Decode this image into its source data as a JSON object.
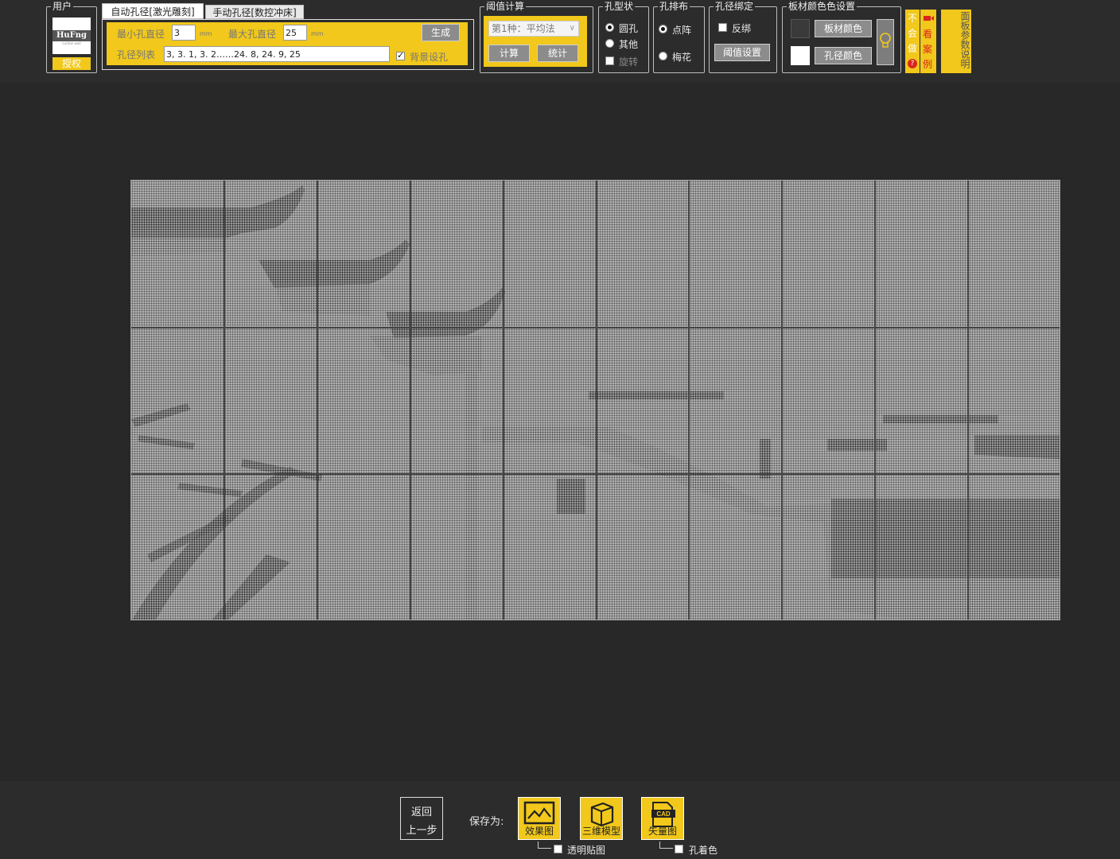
{
  "user_group": {
    "legend": "用户",
    "logo_text": "HuFng",
    "logo_sub": "curtain wall",
    "auth_button": "授权"
  },
  "tabs": [
    {
      "label": "自动孔径[激光雕刻]",
      "active": true
    },
    {
      "label": "手动孔径[数控冲床]",
      "active": false
    }
  ],
  "auto_panel": {
    "min_label": "最小孔直径",
    "min_value": "3",
    "min_unit": "mm",
    "max_label": "最大孔直径",
    "max_value": "25",
    "max_unit": "mm",
    "generate_button": "生成",
    "list_label": "孔径列表",
    "list_value": "3, 3. 1, 3. 2……24. 8, 24. 9, 25",
    "bg_hole_label": "背景设孔",
    "bg_hole_checked": true
  },
  "threshold": {
    "legend": "阈值计算",
    "method_select": "第1种：平均法",
    "calc_button": "计算",
    "stats_button": "统计"
  },
  "hole_shape": {
    "legend": "孔型状",
    "options": [
      "圆孔",
      "其他"
    ],
    "selected": "圆孔",
    "rotate_label": "旋转"
  },
  "hole_layout": {
    "legend": "孔排布",
    "options": [
      "点阵",
      "梅花"
    ],
    "selected": "点阵"
  },
  "diameter_bind": {
    "legend": "孔径绑定",
    "invert_label": "反绑",
    "threshold_button": "阈值设置"
  },
  "color_settings": {
    "legend": "板材颜色色设置",
    "plate_color_button": "板材颜色",
    "hole_color_button": "孔径颜色",
    "plate_swatch": "#3a3a3a",
    "hole_swatch": "#ffffff"
  },
  "side_buttons": {
    "cant_do": "不会做",
    "watch_cases": "看案例",
    "panel_params": "面板参数说明"
  },
  "bottom": {
    "back_line1": "返回",
    "back_line2": "上一步",
    "save_as": "保存为:",
    "effect_button": "效果图",
    "model_button": "三维模型",
    "vector_button": "矢量图",
    "cad_badge": "CAD",
    "transparent_label": "透明贴图",
    "hole_color_label": "孔着色"
  },
  "colors": {
    "accent": "#f1c81b",
    "background": "#282828",
    "toolbar": "#2c2c2c"
  }
}
